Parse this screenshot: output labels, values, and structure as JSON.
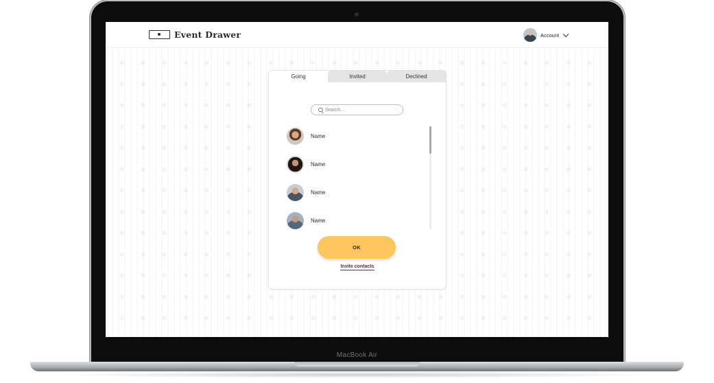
{
  "device": {
    "model_label": "MacBook Air"
  },
  "header": {
    "brand": "Event Drawer",
    "account_label": "Account"
  },
  "dialog": {
    "tabs": [
      {
        "label": "Going",
        "active": true
      },
      {
        "label": "Invited",
        "active": false
      },
      {
        "label": "Declined",
        "active": false
      }
    ],
    "search": {
      "placeholder": "Search..."
    },
    "people": [
      {
        "name": "Name"
      },
      {
        "name": "Name"
      },
      {
        "name": "Name"
      },
      {
        "name": "Name"
      }
    ],
    "ok_label": "OK",
    "invite_label": "Invite contacts"
  },
  "colors": {
    "accent": "#fdc65d",
    "link": "#6b2b2b"
  }
}
